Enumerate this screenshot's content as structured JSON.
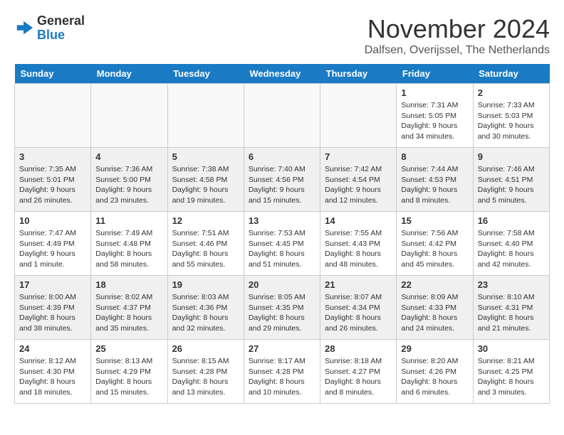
{
  "header": {
    "logo": {
      "general": "General",
      "blue": "Blue"
    },
    "title": "November 2024",
    "location": "Dalfsen, Overijssel, The Netherlands"
  },
  "columns": [
    "Sunday",
    "Monday",
    "Tuesday",
    "Wednesday",
    "Thursday",
    "Friday",
    "Saturday"
  ],
  "weeks": [
    {
      "days": [
        {
          "num": "",
          "empty": true
        },
        {
          "num": "",
          "empty": true
        },
        {
          "num": "",
          "empty": true
        },
        {
          "num": "",
          "empty": true
        },
        {
          "num": "",
          "empty": true
        },
        {
          "num": "1",
          "sunrise": "Sunrise: 7:31 AM",
          "sunset": "Sunset: 5:05 PM",
          "daylight": "Daylight: 9 hours and 34 minutes."
        },
        {
          "num": "2",
          "sunrise": "Sunrise: 7:33 AM",
          "sunset": "Sunset: 5:03 PM",
          "daylight": "Daylight: 9 hours and 30 minutes."
        }
      ]
    },
    {
      "days": [
        {
          "num": "3",
          "sunrise": "Sunrise: 7:35 AM",
          "sunset": "Sunset: 5:01 PM",
          "daylight": "Daylight: 9 hours and 26 minutes."
        },
        {
          "num": "4",
          "sunrise": "Sunrise: 7:36 AM",
          "sunset": "Sunset: 5:00 PM",
          "daylight": "Daylight: 9 hours and 23 minutes."
        },
        {
          "num": "5",
          "sunrise": "Sunrise: 7:38 AM",
          "sunset": "Sunset: 4:58 PM",
          "daylight": "Daylight: 9 hours and 19 minutes."
        },
        {
          "num": "6",
          "sunrise": "Sunrise: 7:40 AM",
          "sunset": "Sunset: 4:56 PM",
          "daylight": "Daylight: 9 hours and 15 minutes."
        },
        {
          "num": "7",
          "sunrise": "Sunrise: 7:42 AM",
          "sunset": "Sunset: 4:54 PM",
          "daylight": "Daylight: 9 hours and 12 minutes."
        },
        {
          "num": "8",
          "sunrise": "Sunrise: 7:44 AM",
          "sunset": "Sunset: 4:53 PM",
          "daylight": "Daylight: 9 hours and 8 minutes."
        },
        {
          "num": "9",
          "sunrise": "Sunrise: 7:46 AM",
          "sunset": "Sunset: 4:51 PM",
          "daylight": "Daylight: 9 hours and 5 minutes."
        }
      ]
    },
    {
      "days": [
        {
          "num": "10",
          "sunrise": "Sunrise: 7:47 AM",
          "sunset": "Sunset: 4:49 PM",
          "daylight": "Daylight: 9 hours and 1 minute."
        },
        {
          "num": "11",
          "sunrise": "Sunrise: 7:49 AM",
          "sunset": "Sunset: 4:48 PM",
          "daylight": "Daylight: 8 hours and 58 minutes."
        },
        {
          "num": "12",
          "sunrise": "Sunrise: 7:51 AM",
          "sunset": "Sunset: 4:46 PM",
          "daylight": "Daylight: 8 hours and 55 minutes."
        },
        {
          "num": "13",
          "sunrise": "Sunrise: 7:53 AM",
          "sunset": "Sunset: 4:45 PM",
          "daylight": "Daylight: 8 hours and 51 minutes."
        },
        {
          "num": "14",
          "sunrise": "Sunrise: 7:55 AM",
          "sunset": "Sunset: 4:43 PM",
          "daylight": "Daylight: 8 hours and 48 minutes."
        },
        {
          "num": "15",
          "sunrise": "Sunrise: 7:56 AM",
          "sunset": "Sunset: 4:42 PM",
          "daylight": "Daylight: 8 hours and 45 minutes."
        },
        {
          "num": "16",
          "sunrise": "Sunrise: 7:58 AM",
          "sunset": "Sunset: 4:40 PM",
          "daylight": "Daylight: 8 hours and 42 minutes."
        }
      ]
    },
    {
      "days": [
        {
          "num": "17",
          "sunrise": "Sunrise: 8:00 AM",
          "sunset": "Sunset: 4:39 PM",
          "daylight": "Daylight: 8 hours and 38 minutes."
        },
        {
          "num": "18",
          "sunrise": "Sunrise: 8:02 AM",
          "sunset": "Sunset: 4:37 PM",
          "daylight": "Daylight: 8 hours and 35 minutes."
        },
        {
          "num": "19",
          "sunrise": "Sunrise: 8:03 AM",
          "sunset": "Sunset: 4:36 PM",
          "daylight": "Daylight: 8 hours and 32 minutes."
        },
        {
          "num": "20",
          "sunrise": "Sunrise: 8:05 AM",
          "sunset": "Sunset: 4:35 PM",
          "daylight": "Daylight: 8 hours and 29 minutes."
        },
        {
          "num": "21",
          "sunrise": "Sunrise: 8:07 AM",
          "sunset": "Sunset: 4:34 PM",
          "daylight": "Daylight: 8 hours and 26 minutes."
        },
        {
          "num": "22",
          "sunrise": "Sunrise: 8:09 AM",
          "sunset": "Sunset: 4:33 PM",
          "daylight": "Daylight: 8 hours and 24 minutes."
        },
        {
          "num": "23",
          "sunrise": "Sunrise: 8:10 AM",
          "sunset": "Sunset: 4:31 PM",
          "daylight": "Daylight: 8 hours and 21 minutes."
        }
      ]
    },
    {
      "days": [
        {
          "num": "24",
          "sunrise": "Sunrise: 8:12 AM",
          "sunset": "Sunset: 4:30 PM",
          "daylight": "Daylight: 8 hours and 18 minutes."
        },
        {
          "num": "25",
          "sunrise": "Sunrise: 8:13 AM",
          "sunset": "Sunset: 4:29 PM",
          "daylight": "Daylight: 8 hours and 15 minutes."
        },
        {
          "num": "26",
          "sunrise": "Sunrise: 8:15 AM",
          "sunset": "Sunset: 4:28 PM",
          "daylight": "Daylight: 8 hours and 13 minutes."
        },
        {
          "num": "27",
          "sunrise": "Sunrise: 8:17 AM",
          "sunset": "Sunset: 4:28 PM",
          "daylight": "Daylight: 8 hours and 10 minutes."
        },
        {
          "num": "28",
          "sunrise": "Sunrise: 8:18 AM",
          "sunset": "Sunset: 4:27 PM",
          "daylight": "Daylight: 8 hours and 8 minutes."
        },
        {
          "num": "29",
          "sunrise": "Sunrise: 8:20 AM",
          "sunset": "Sunset: 4:26 PM",
          "daylight": "Daylight: 8 hours and 6 minutes."
        },
        {
          "num": "30",
          "sunrise": "Sunrise: 8:21 AM",
          "sunset": "Sunset: 4:25 PM",
          "daylight": "Daylight: 8 hours and 3 minutes."
        }
      ]
    }
  ],
  "colors": {
    "header_bg": "#1a7bc4",
    "accent": "#1a7bc4"
  }
}
